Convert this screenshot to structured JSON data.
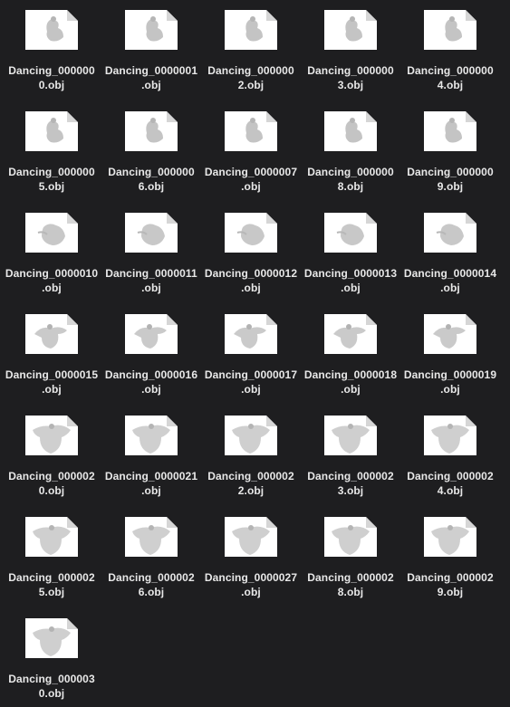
{
  "files": [
    {
      "line1": "Dancing_000000",
      "line2": "0.obj",
      "pose": 0
    },
    {
      "line1": "Dancing_0000001",
      "line2": ".obj",
      "pose": 0
    },
    {
      "line1": "Dancing_000000",
      "line2": "2.obj",
      "pose": 0
    },
    {
      "line1": "Dancing_000000",
      "line2": "3.obj",
      "pose": 0
    },
    {
      "line1": "Dancing_000000",
      "line2": "4.obj",
      "pose": 0
    },
    {
      "line1": "Dancing_000000",
      "line2": "5.obj",
      "pose": 0
    },
    {
      "line1": "Dancing_000000",
      "line2": "6.obj",
      "pose": 0
    },
    {
      "line1": "Dancing_0000007",
      "line2": ".obj",
      "pose": 0
    },
    {
      "line1": "Dancing_000000",
      "line2": "8.obj",
      "pose": 0
    },
    {
      "line1": "Dancing_000000",
      "line2": "9.obj",
      "pose": 0
    },
    {
      "line1": "Dancing_0000010",
      "line2": ".obj",
      "pose": 1
    },
    {
      "line1": "Dancing_0000011",
      "line2": ".obj",
      "pose": 1
    },
    {
      "line1": "Dancing_0000012",
      "line2": ".obj",
      "pose": 1
    },
    {
      "line1": "Dancing_0000013",
      "line2": ".obj",
      "pose": 1
    },
    {
      "line1": "Dancing_0000014",
      "line2": ".obj",
      "pose": 1
    },
    {
      "line1": "Dancing_0000015",
      "line2": ".obj",
      "pose": 2
    },
    {
      "line1": "Dancing_0000016",
      "line2": ".obj",
      "pose": 2
    },
    {
      "line1": "Dancing_0000017",
      "line2": ".obj",
      "pose": 2
    },
    {
      "line1": "Dancing_0000018",
      "line2": ".obj",
      "pose": 2
    },
    {
      "line1": "Dancing_0000019",
      "line2": ".obj",
      "pose": 2
    },
    {
      "line1": "Dancing_000002",
      "line2": "0.obj",
      "pose": 3
    },
    {
      "line1": "Dancing_0000021",
      "line2": ".obj",
      "pose": 3
    },
    {
      "line1": "Dancing_000002",
      "line2": "2.obj",
      "pose": 3
    },
    {
      "line1": "Dancing_000002",
      "line2": "3.obj",
      "pose": 3
    },
    {
      "line1": "Dancing_000002",
      "line2": "4.obj",
      "pose": 3
    },
    {
      "line1": "Dancing_000002",
      "line2": "5.obj",
      "pose": 3
    },
    {
      "line1": "Dancing_000002",
      "line2": "6.obj",
      "pose": 3
    },
    {
      "line1": "Dancing_0000027",
      "line2": ".obj",
      "pose": 3
    },
    {
      "line1": "Dancing_000002",
      "line2": "8.obj",
      "pose": 3
    },
    {
      "line1": "Dancing_000002",
      "line2": "9.obj",
      "pose": 3
    },
    {
      "line1": "Dancing_000003",
      "line2": "0.obj",
      "pose": 3
    }
  ],
  "icon": "obj-file-thumbnail-icon",
  "colors": {
    "background": "#1e1e20",
    "page": "#ffffff",
    "fold": "#d6d6d6",
    "figure": "#bdbdbd",
    "label": "#e8e8e8"
  }
}
